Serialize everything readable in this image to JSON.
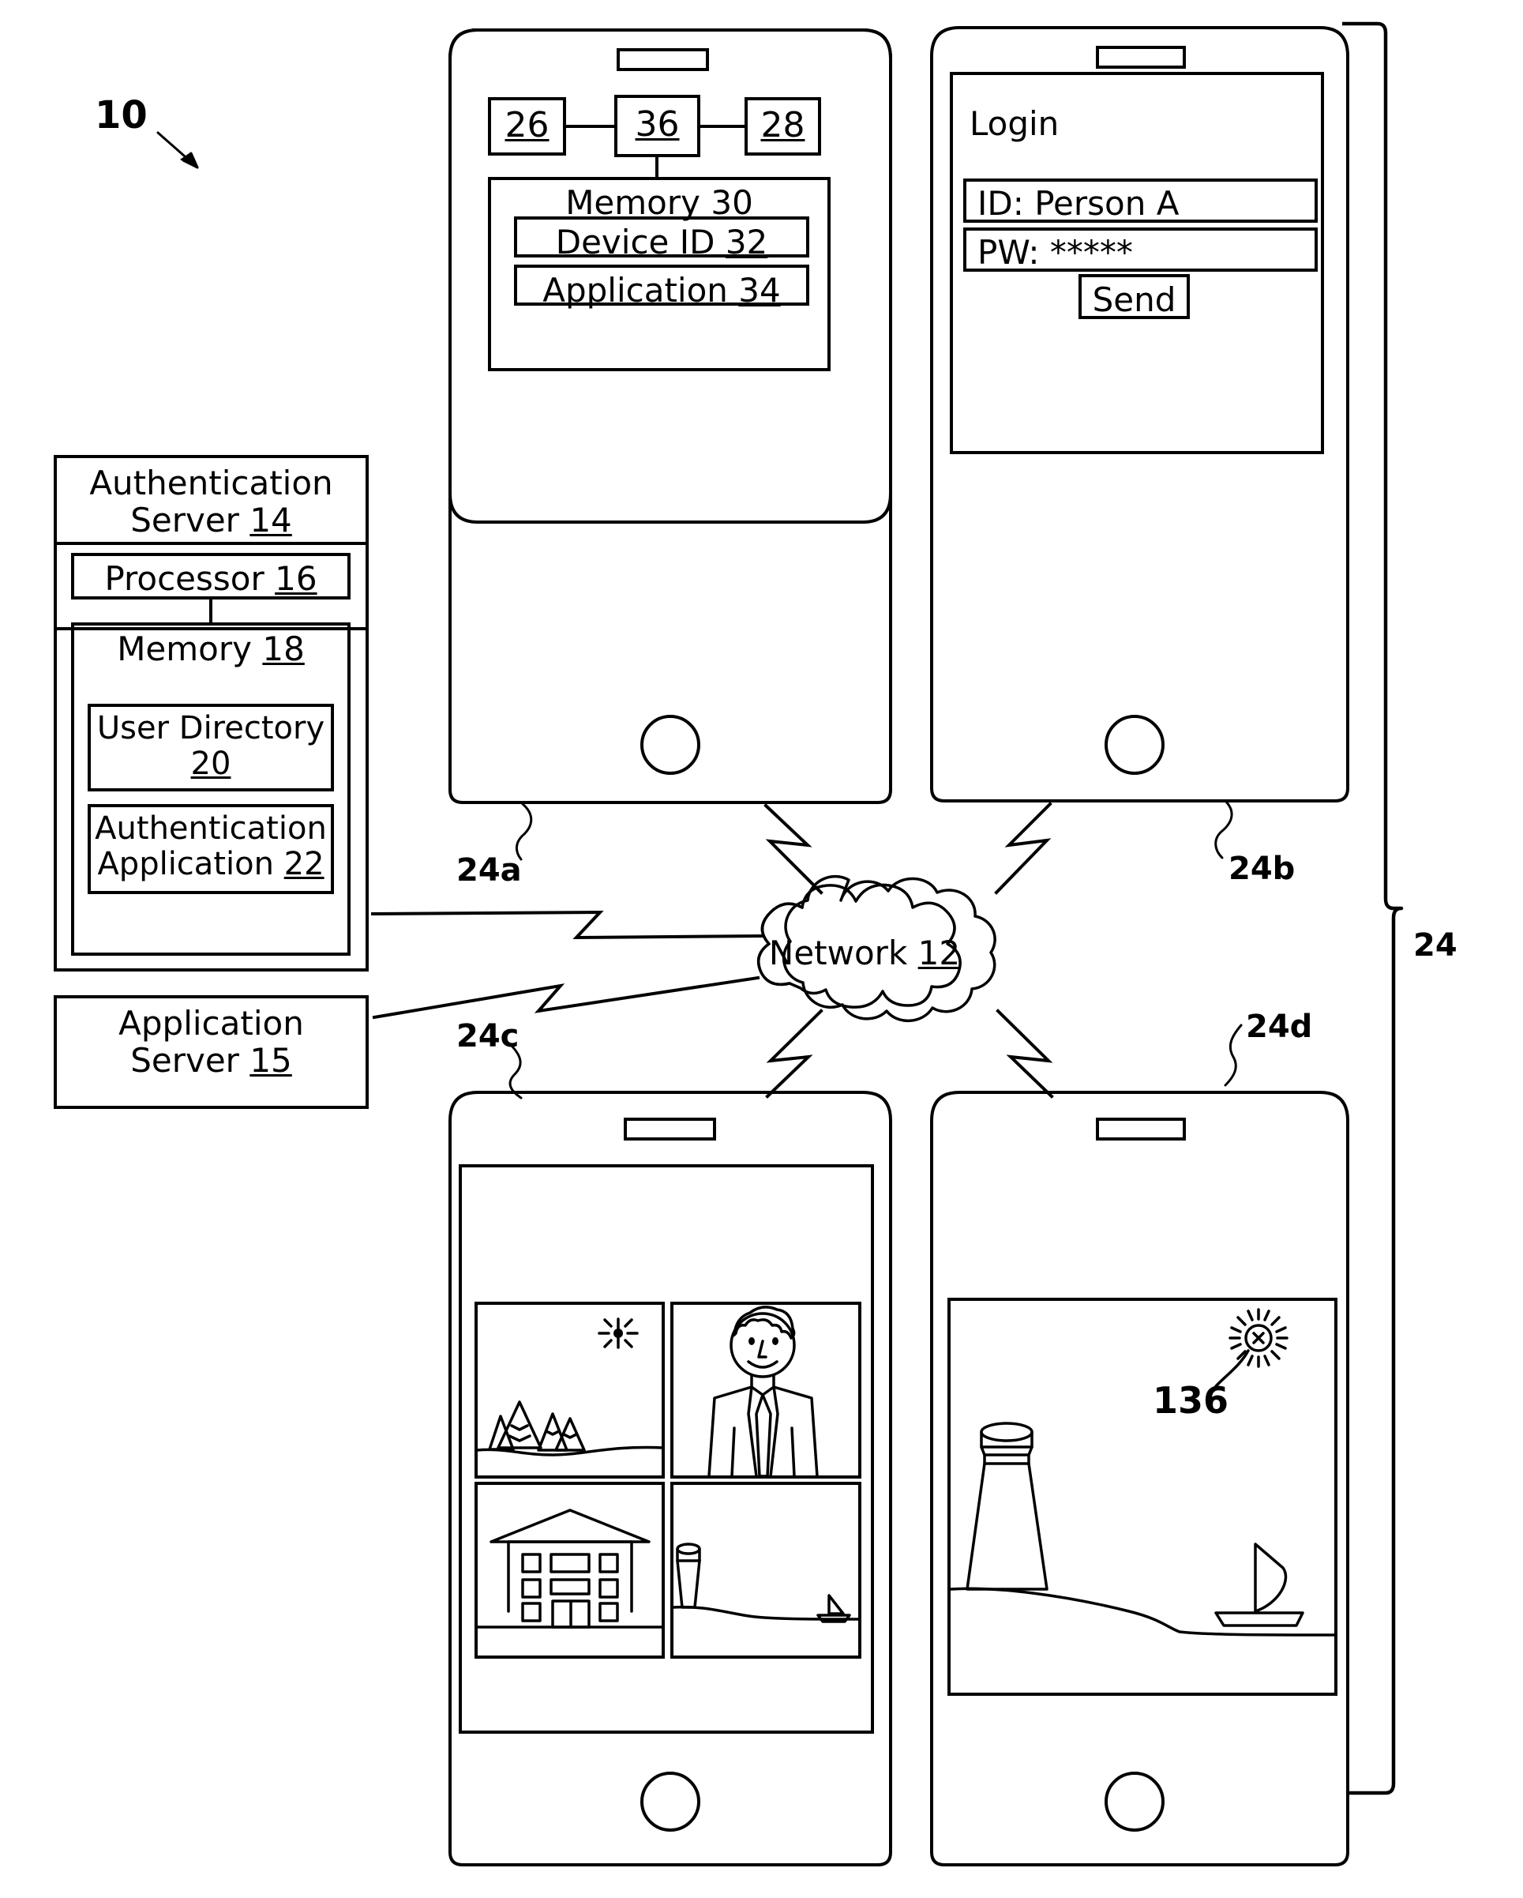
{
  "figure": {
    "figure_number": "10",
    "system_bracket_label": "24"
  },
  "network": {
    "label": "Network",
    "ref": "12",
    "icon": "cloud-icon"
  },
  "auth_server": {
    "title_line1": "Authentication",
    "title_line2": "Server",
    "ref": "14",
    "processor": {
      "label": "Processor",
      "ref": "16"
    },
    "memory": {
      "label": "Memory",
      "ref": "18",
      "items": [
        {
          "label": "User Directory",
          "ref": "20"
        },
        {
          "label_line1": "Authentication",
          "label_line2": "Application",
          "ref": "22"
        }
      ]
    }
  },
  "app_server": {
    "title_line1": "Application",
    "title_line2": "Server",
    "ref": "15"
  },
  "devices": [
    {
      "id": "24a",
      "ref_label": "24a",
      "type": "hardware-block-phone",
      "blocks": [
        {
          "ref": "26"
        },
        {
          "ref": "36"
        },
        {
          "ref": "28"
        }
      ],
      "memory": {
        "label": "Memory",
        "ref": "30",
        "items": [
          {
            "label": "Device ID",
            "ref": "32"
          },
          {
            "label": "Application",
            "ref": "34"
          }
        ]
      }
    },
    {
      "id": "24b",
      "ref_label": "24b",
      "type": "login-phone",
      "screen": {
        "title": "Login",
        "fields": [
          {
            "name": "id-field",
            "value": "ID: Person A"
          },
          {
            "name": "password-field",
            "value": "PW: *****"
          }
        ],
        "send_button": "Send"
      }
    },
    {
      "id": "24c",
      "ref_label": "24c",
      "type": "gallery-phone",
      "thumbnails": [
        {
          "name": "thumbnail-mountains",
          "subject": "mountain landscape with sun"
        },
        {
          "name": "thumbnail-person",
          "subject": "person in suit and tie"
        },
        {
          "name": "thumbnail-building",
          "subject": "building with windows"
        },
        {
          "name": "thumbnail-lighthouse",
          "subject": "lighthouse with sailboat"
        }
      ]
    },
    {
      "id": "24d",
      "ref_label": "24d",
      "type": "photo-detail-phone",
      "photo": {
        "name": "photo-lighthouse-scene",
        "subject": "lighthouse shoreline with sailboat and sun",
        "annotation_ref": "136"
      }
    }
  ]
}
